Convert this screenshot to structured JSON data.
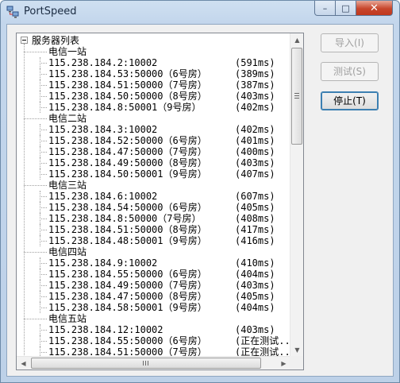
{
  "window": {
    "title": "PortSpeed"
  },
  "titlebar_buttons": {
    "minimize": "–",
    "maximize": "□",
    "close": "✕"
  },
  "tree": {
    "root_label": "服务器列表",
    "rows": [
      {
        "kind": "group",
        "label": "电信一站"
      },
      {
        "kind": "item",
        "label": "115.238.184.2:10002",
        "ms": "(591ms)"
      },
      {
        "kind": "item",
        "label": "115.238.184.53:50000（6号房）",
        "ms": "(389ms)"
      },
      {
        "kind": "item",
        "label": "115.238.184.51:50000（7号房）",
        "ms": "(387ms)"
      },
      {
        "kind": "item",
        "label": "115.238.184.50:50000（8号房）",
        "ms": "(403ms)"
      },
      {
        "kind": "item",
        "label": "115.238.184.8:50001（9号房）",
        "ms": "(402ms)"
      },
      {
        "kind": "group",
        "label": "电信二站"
      },
      {
        "kind": "item",
        "label": "115.238.184.3:10002",
        "ms": "(402ms)"
      },
      {
        "kind": "item",
        "label": "115.238.184.52:50000（6号房）",
        "ms": "(401ms)"
      },
      {
        "kind": "item",
        "label": "115.238.184.47:50000（7号房）",
        "ms": "(400ms)"
      },
      {
        "kind": "item",
        "label": "115.238.184.49:50000（8号房）",
        "ms": "(403ms)"
      },
      {
        "kind": "item",
        "label": "115.238.184.50:50001（9号房）",
        "ms": "(407ms)"
      },
      {
        "kind": "group",
        "label": "电信三站"
      },
      {
        "kind": "item",
        "label": "115.238.184.6:10002",
        "ms": "(607ms)"
      },
      {
        "kind": "item",
        "label": "115.238.184.54:50000（6号房）",
        "ms": "(405ms)"
      },
      {
        "kind": "item",
        "label": "115.238.184.8:50000（7号房）",
        "ms": "(408ms)"
      },
      {
        "kind": "item",
        "label": "115.238.184.51:50000（8号房）",
        "ms": "(417ms)"
      },
      {
        "kind": "item",
        "label": "115.238.184.48:50001（9号房）",
        "ms": "(416ms)"
      },
      {
        "kind": "group",
        "label": "电信四站"
      },
      {
        "kind": "item",
        "label": "115.238.184.9:10002",
        "ms": "(410ms)"
      },
      {
        "kind": "item",
        "label": "115.238.184.55:50000（6号房）",
        "ms": "(404ms)"
      },
      {
        "kind": "item",
        "label": "115.238.184.49:50000（7号房）",
        "ms": "(403ms)"
      },
      {
        "kind": "item",
        "label": "115.238.184.47:50000（8号房）",
        "ms": "(405ms)"
      },
      {
        "kind": "item",
        "label": "115.238.184.58:50001（9号房）",
        "ms": "(404ms)"
      },
      {
        "kind": "group",
        "label": "电信五站"
      },
      {
        "kind": "item",
        "label": "115.238.184.12:10002",
        "ms": "(403ms)"
      },
      {
        "kind": "item",
        "label": "115.238.184.55:50000（6号房）",
        "ms": "(正在测试..."
      },
      {
        "kind": "item",
        "label": "115.238.184.51:50000（7号房）",
        "ms": "(正在测试..."
      }
    ]
  },
  "buttons": {
    "import": "导入(I)",
    "test": "测试(S)",
    "stop": "停止(T)"
  },
  "icons": {
    "app": "network-computers-icon"
  }
}
